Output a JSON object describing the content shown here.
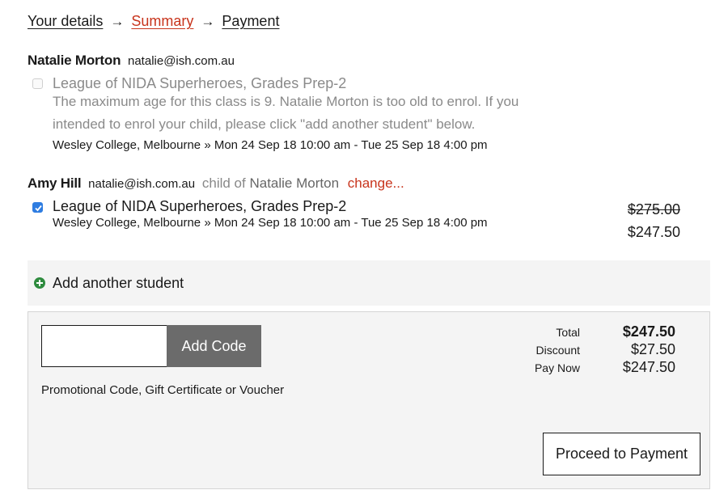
{
  "breadcrumb": {
    "step1": "Your details",
    "step2": "Summary",
    "step3": "Payment",
    "arrow": "→"
  },
  "students": [
    {
      "name": "Natalie Morton",
      "email": "natalie@ish.com.au",
      "class_title": "League of NIDA Superheroes, Grades Prep-2",
      "warning": "The maximum age for this class is 9. Natalie Morton is too old to enrol. If you intended to enrol your child, please click \"add another student\" below.",
      "class_meta": "Wesley College, Melbourne » Mon 24 Sep 18 10:00 am - Tue 25 Sep 18 4:00 pm",
      "checked": false
    },
    {
      "name": "Amy Hill",
      "email": "natalie@ish.com.au",
      "child_of_text": "child of",
      "parent_name": "Natalie Morton",
      "change_label": "change...",
      "class_title": "League of NIDA Superheroes, Grades Prep-2",
      "class_meta": "Wesley College, Melbourne » Mon 24 Sep 18 10:00 am - Tue 25 Sep 18 4:00 pm",
      "price_original": "$275.00",
      "price_discounted": "$247.50",
      "checked": true
    }
  ],
  "add_student": {
    "label": "Add another student",
    "icon": "plus-circle-icon"
  },
  "promo": {
    "input_value": "",
    "button_label": "Add Code",
    "label": "Promotional Code, Gift Certificate or Voucher"
  },
  "totals": {
    "total_label": "Total",
    "total_value": "$247.50",
    "discount_label": "Discount",
    "discount_value": "$27.50",
    "pay_now_label": "Pay Now",
    "pay_now_value": "$247.50"
  },
  "proceed_label": "Proceed to Payment",
  "colors": {
    "accent_red": "#c8341c",
    "checkbox_blue": "#2f7de1",
    "add_green": "#2e8b3e",
    "button_grey": "#6b6b6b"
  }
}
